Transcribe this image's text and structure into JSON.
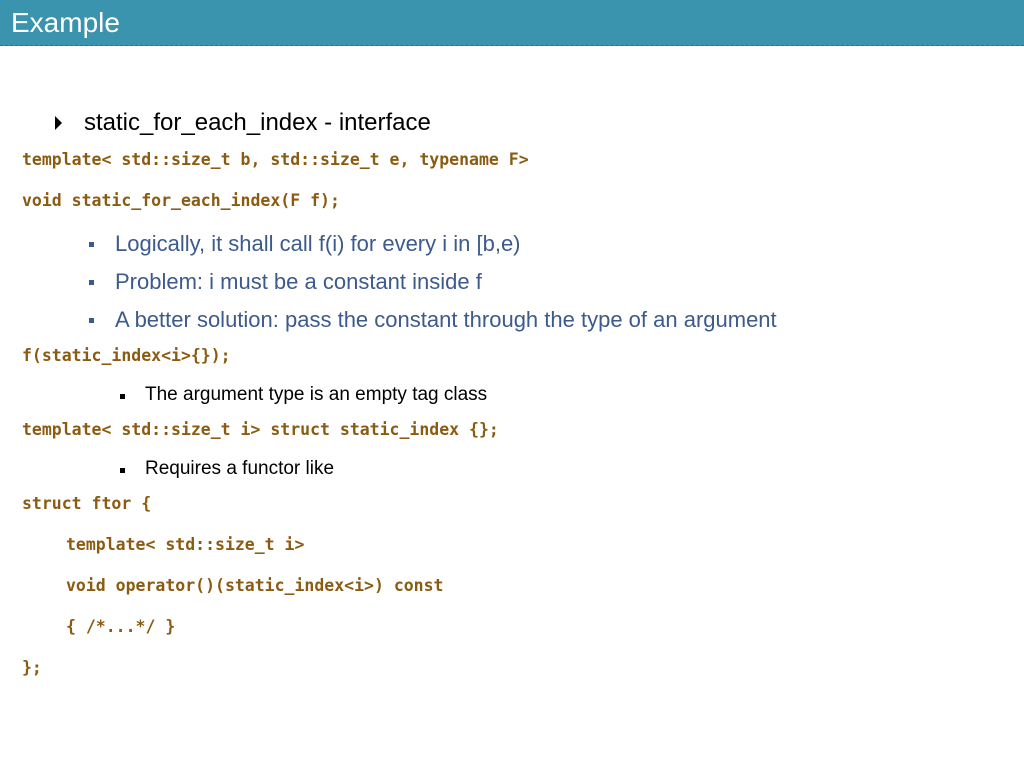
{
  "slide": {
    "title": "Example"
  },
  "content": {
    "bullet_interface": "static_for_each_index - interface",
    "code_template_decl": "template< std::size_t b, std::size_t e, typename F>",
    "code_void_decl": "void static_for_each_index(F f);",
    "sub_bullets": [
      "Logically, it shall call f(i) for every i in [b,e)",
      "Problem: i must be a constant inside f",
      "A better solution: pass the constant through the type of an argument"
    ],
    "code_call": "f(static_index<i>{});",
    "note_argument_type": "The argument type is an empty tag class",
    "code_static_index": "template< std::size_t i> struct static_index {};",
    "note_functor": "Requires a functor like",
    "code_ftor": [
      "struct ftor {",
      "template< std::size_t i>",
      "void operator()(static_index<i>) const",
      "{ /*...*/ }",
      "};"
    ]
  }
}
